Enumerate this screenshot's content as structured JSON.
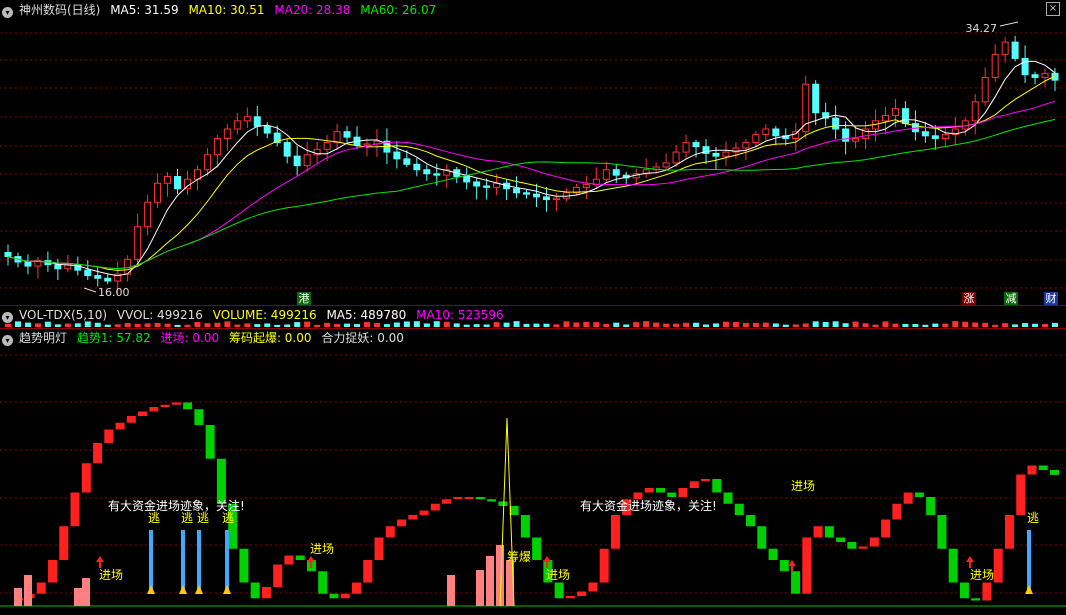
{
  "main_header": {
    "stock_name": "神州数码(日线)",
    "ma5": "MA5: 31.59",
    "ma10": "MA10: 30.51",
    "ma20": "MA20: 28.38",
    "ma60": "MA60: 26.07"
  },
  "vol_header": {
    "name": "VOL-TDX(5,10)",
    "vvol": "VVOL: 499216",
    "volume": "VOLUME: 499216",
    "ma5": "MA5: 489780",
    "ma10": "MA10: 523596"
  },
  "ind_header": {
    "name": "趋势明灯",
    "trend": "趋势1: 57.82",
    "enter": "进场: 0.00",
    "chip": "筹码起爆: 0.00",
    "catch": "合力捉妖: 0.00"
  },
  "labels": {
    "high": "34.27",
    "low": "16.00",
    "event_gang": "港",
    "event_zhang": "涨",
    "event_jian": "减",
    "event_cai": "财",
    "close_btn": "×"
  },
  "annotations": [
    {
      "text": "有大资金进场迹象，关注!"
    },
    {
      "text": "有大资金进场迹象，关注!"
    },
    {
      "text": "进场"
    },
    {
      "text": "进场"
    },
    {
      "text": "进场"
    },
    {
      "text": "进场"
    },
    {
      "text": "进场"
    },
    {
      "text": "筹爆"
    },
    {
      "text": "逃"
    },
    {
      "text": "逃"
    },
    {
      "text": "逃"
    },
    {
      "text": "逃"
    },
    {
      "text": "逃"
    }
  ],
  "colors": {
    "up": "#ff3232",
    "down": "#54fcfc",
    "ma5": "#ffffff",
    "ma10": "#ffff00",
    "ma20": "#ff00ff",
    "ma60": "#00e600",
    "trend_up": "#ff2020",
    "trend_down": "#00d000",
    "grid": "#8b0000"
  },
  "chart_data": {
    "type": "candlestick",
    "title": "神州数码(日线)",
    "ylim": [
      15,
      36
    ],
    "high_label": 34.27,
    "low_label": 16.0,
    "closes": [
      18.2,
      17.8,
      17.5,
      17.9,
      17.6,
      17.3,
      17.6,
      17.2,
      16.8,
      16.6,
      16.4,
      16.9,
      18.0,
      20.4,
      22.2,
      23.6,
      24.1,
      23.2,
      23.9,
      24.6,
      25.7,
      26.9,
      27.6,
      28.2,
      28.5,
      27.8,
      27.3,
      26.6,
      25.6,
      24.9,
      25.7,
      26.1,
      26.6,
      27.4,
      27.0,
      26.4,
      26.5,
      26.7,
      25.9,
      25.4,
      25.0,
      24.6,
      24.3,
      24.2,
      24.6,
      24.1,
      23.7,
      23.4,
      23.3,
      23.6,
      23.2,
      22.9,
      22.8,
      22.6,
      22.4,
      22.5,
      22.9,
      23.3,
      23.5,
      23.9,
      24.6,
      24.2,
      24.0,
      24.3,
      24.6,
      24.8,
      25.1,
      25.9,
      26.6,
      26.3,
      25.8,
      25.6,
      25.9,
      26.2,
      26.6,
      27.2,
      27.6,
      27.1,
      26.9,
      27.4,
      30.9,
      28.8,
      28.4,
      27.6,
      26.7,
      26.9,
      27.6,
      28.2,
      28.6,
      29.1,
      28.0,
      27.4,
      27.1,
      26.9,
      27.2,
      27.6,
      28.2,
      29.6,
      31.4,
      33.1,
      34.0,
      32.8,
      31.6,
      31.4,
      31.7,
      31.2
    ],
    "ma5_label": 31.59,
    "ma10_label": 30.51,
    "ma20_label": 28.38,
    "ma60_label": 26.07,
    "volume_pane": {
      "vvol": 499216,
      "ma5": 489780,
      "ma10": 523596
    },
    "indicator": {
      "name": "趋势明灯",
      "trend1": [
        2,
        3,
        5,
        10,
        20,
        35,
        50,
        63,
        72,
        78,
        81,
        84,
        86,
        88,
        89,
        90,
        87,
        80,
        65,
        45,
        25,
        10,
        3,
        8,
        18,
        22,
        20,
        15,
        5,
        3,
        5,
        10,
        20,
        30,
        35,
        38,
        40,
        42,
        45,
        47,
        48,
        48,
        47,
        46,
        44,
        40,
        30,
        20,
        10,
        3,
        4,
        6,
        10,
        25,
        40,
        47,
        50,
        52,
        50,
        48,
        52,
        55,
        56,
        50,
        45,
        40,
        35,
        25,
        20,
        15,
        5,
        30,
        35,
        30,
        28,
        25,
        26,
        30,
        38,
        45,
        50,
        48,
        40,
        25,
        10,
        3,
        2,
        10,
        25,
        40,
        58,
        62,
        60,
        57.82
      ],
      "enter": 0,
      "chip_burst": 0,
      "catch_demon": 0
    }
  }
}
